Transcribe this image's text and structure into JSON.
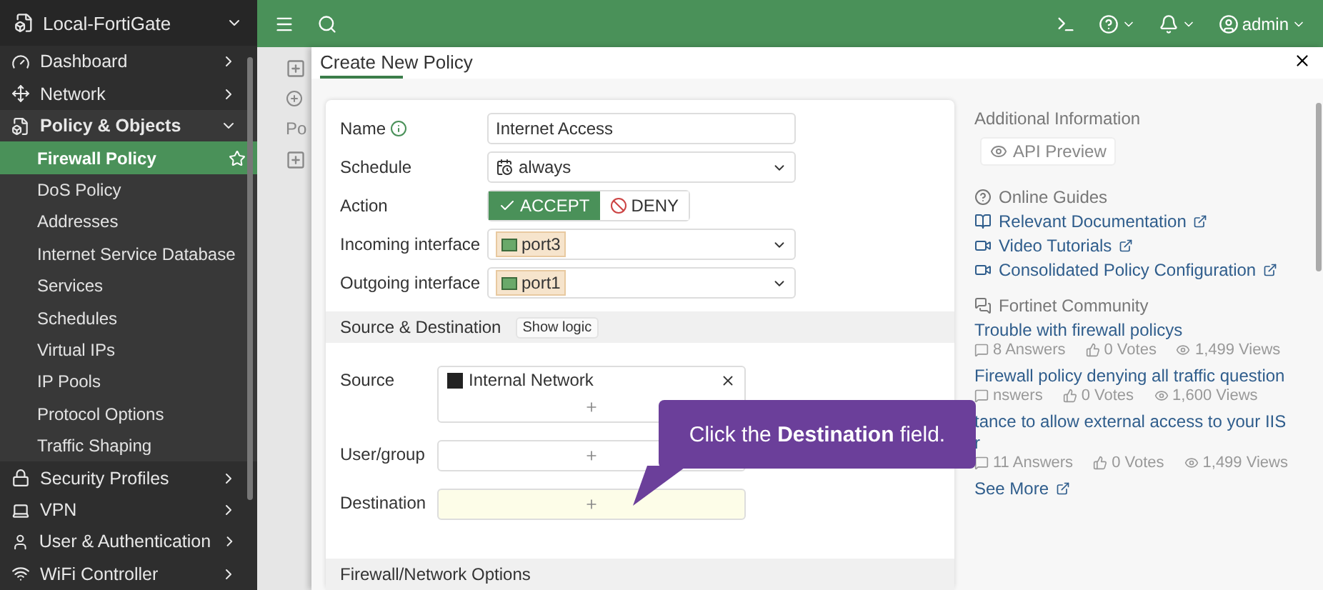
{
  "sidebar": {
    "device": "Local-FortiGate",
    "items": [
      {
        "label": "Dashboard",
        "expanded": false
      },
      {
        "label": "Network",
        "expanded": false
      },
      {
        "label": "Policy & Objects",
        "expanded": true,
        "children": [
          {
            "label": "Firewall Policy",
            "selected": true,
            "favorite": true
          },
          {
            "label": "DoS Policy",
            "selected": false
          },
          {
            "label": "Addresses",
            "selected": false
          },
          {
            "label": "Internet Service Database",
            "selected": false
          },
          {
            "label": "Services",
            "selected": false
          },
          {
            "label": "Schedules",
            "selected": false
          },
          {
            "label": "Virtual IPs",
            "selected": false
          },
          {
            "label": "IP Pools",
            "selected": false
          },
          {
            "label": "Protocol Options",
            "selected": false
          },
          {
            "label": "Traffic Shaping",
            "selected": false
          }
        ]
      },
      {
        "label": "Security Profiles",
        "expanded": false
      },
      {
        "label": "VPN",
        "expanded": false
      },
      {
        "label": "User & Authentication",
        "expanded": false
      },
      {
        "label": "WiFi Controller",
        "expanded": false
      }
    ]
  },
  "topbar": {
    "user": "admin"
  },
  "background_list": {
    "column_header": "Po"
  },
  "dialog": {
    "title": "Create New Policy",
    "fields": [
      {
        "kind": "text",
        "label": "Name",
        "info": true,
        "value": "Internet Access"
      },
      {
        "kind": "select",
        "label": "Schedule",
        "value": "always"
      },
      {
        "kind": "toggle",
        "label": "Action",
        "options": [
          {
            "label": "ACCEPT",
            "selected": true
          },
          {
            "label": "DENY",
            "selected": false
          }
        ]
      },
      {
        "kind": "tagselect",
        "label": "Incoming interface",
        "value": "port3"
      },
      {
        "kind": "tagselect",
        "label": "Outgoing interface",
        "value": "port1"
      }
    ],
    "section1": {
      "title": "Source & Destination",
      "button": "Show logic"
    },
    "address_fields": [
      {
        "label": "Source",
        "entries": [
          "Internal Network"
        ],
        "highlighted": false
      },
      {
        "label": "User/group",
        "highlighted": false
      },
      {
        "label": "Destination",
        "highlighted": true
      }
    ],
    "section2": {
      "title": "Firewall/Network Options"
    },
    "side": {
      "title": "Additional Information",
      "api_button": "API Preview",
      "guides_title": "Online Guides",
      "guides": [
        {
          "label": "Relevant Documentation"
        },
        {
          "label": "Video Tutorials"
        },
        {
          "label": "Consolidated Policy Configuration"
        }
      ],
      "community_title": "Fortinet Community",
      "posts": [
        {
          "title": "Trouble with firewall policys",
          "answers": "8 Answers",
          "votes": "0 Votes",
          "views": "1,499 Views"
        },
        {
          "title": "Firewall policy denying all traffic question",
          "answers": "nswers",
          "votes": "0 Votes",
          "views": "1,600 Views"
        },
        {
          "title": "tance to allow external access to your IIS r",
          "answers": "11 Answers",
          "votes": "0 Votes",
          "views": "1,499 Views"
        }
      ],
      "see_more": "See More"
    }
  },
  "callout": {
    "text": "Click the **Destination** field."
  }
}
